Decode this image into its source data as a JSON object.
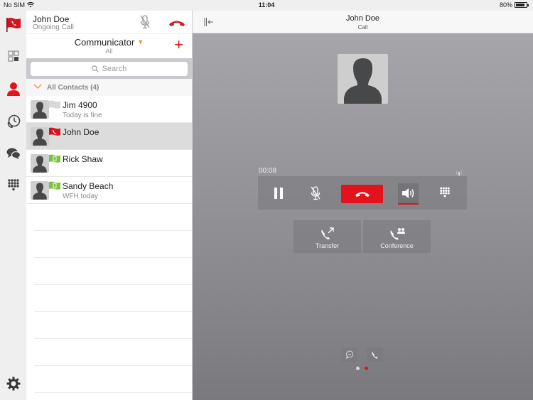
{
  "status_bar": {
    "carrier": "No SIM",
    "wifi_icon": "wifi-icon",
    "time": "11:04",
    "battery_text": "80%",
    "battery_level": 0.8
  },
  "rail": {
    "items": [
      {
        "name": "presence-flag",
        "icon": "red-flag-phone-icon",
        "active": false
      },
      {
        "name": "dashboard",
        "icon": "grid-icon",
        "active": false
      },
      {
        "name": "contacts",
        "icon": "person-icon",
        "active": true
      },
      {
        "name": "history",
        "icon": "call-history-icon",
        "active": false
      },
      {
        "name": "chat",
        "icon": "chat-bubbles-icon",
        "active": false
      },
      {
        "name": "dialpad",
        "icon": "dialpad-icon",
        "active": false
      }
    ],
    "settings_icon": "gear-icon"
  },
  "ongoing_call": {
    "name": "John Doe",
    "status": "Ongoing Call",
    "mute_icon": "mic-muted-icon",
    "hangup_icon": "hangup-icon"
  },
  "communicator": {
    "title": "Communicator",
    "filter": "All",
    "add_label": "+"
  },
  "search": {
    "placeholder": "Search"
  },
  "contacts": {
    "group_label": "All Contacts (4)",
    "items": [
      {
        "name": "Jim 4900",
        "status": "Today is fine",
        "presence": "offline",
        "selected": false
      },
      {
        "name": "John Doe",
        "status": "",
        "presence": "on-call",
        "selected": true
      },
      {
        "name": "Rick Shaw",
        "status": "",
        "presence": "mobile-available",
        "selected": false
      },
      {
        "name": "Sandy Beach",
        "status": "WFH today",
        "presence": "mobile-available",
        "selected": false
      }
    ]
  },
  "call": {
    "header_title": "John Doe",
    "header_subtitle": "Call",
    "timer": "00:08",
    "controls": [
      "hold",
      "mute",
      "end-call",
      "speaker",
      "dialpad"
    ],
    "speaker_active": true,
    "transfer_label": "Transfer",
    "conference_label": "Conference",
    "page_count": 2,
    "active_page": 2
  },
  "colors": {
    "accent_red": "#e4121b",
    "presence_green": "#7dc242",
    "caret_orange": "#f28c28"
  }
}
